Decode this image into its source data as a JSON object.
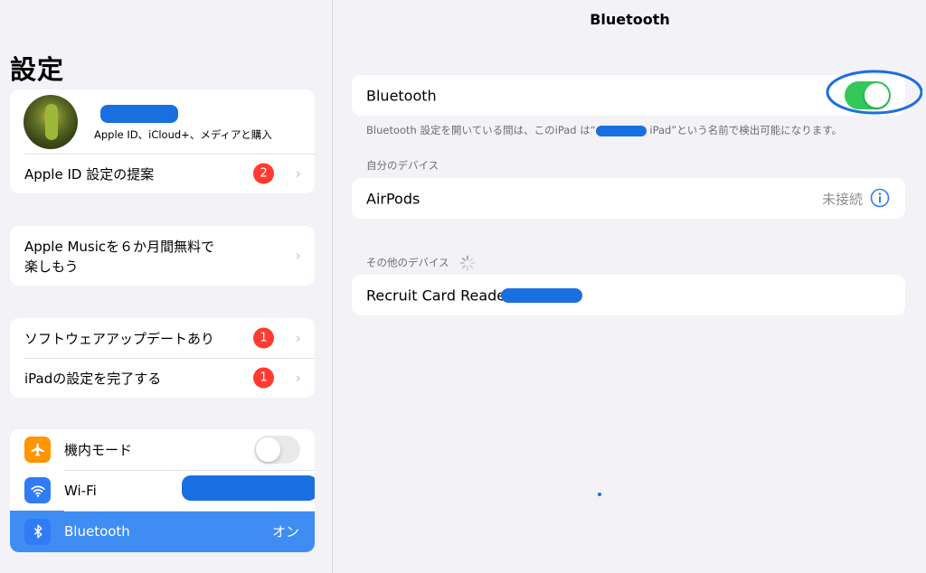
{
  "sidebar": {
    "title": "設定",
    "account": {
      "subtitle": "Apple ID、iCloud+、メディアと購入",
      "suggestion_label": "Apple ID 設定の提案",
      "suggestion_badge": "2"
    },
    "promo": {
      "line1": "Apple Musicを６か月間無料で",
      "line2": "楽しもう"
    },
    "updates": [
      {
        "label": "ソフトウェアアップデートあり",
        "badge": "1"
      },
      {
        "label": "iPadの設定を完了する",
        "badge": "1"
      }
    ],
    "connectivity": [
      {
        "label": "機内モード",
        "icon": "airplane-icon",
        "toggle": "off"
      },
      {
        "label": "Wi-Fi",
        "icon": "wifi-icon"
      },
      {
        "label": "Bluetooth",
        "icon": "bluetooth-icon",
        "value": "オン",
        "selected": true
      }
    ],
    "chevron": "›"
  },
  "main": {
    "nav_title": "Bluetooth",
    "bluetooth_toggle": {
      "label": "Bluetooth",
      "state": "on"
    },
    "visibility_note_prefix": "Bluetooth 設定を開いている間は、このiPad は“",
    "visibility_note_suffix": " iPad”という名前で検出可能になります。",
    "my_devices_header": "自分のデバイス",
    "my_devices": [
      {
        "name": "AirPods",
        "status": "未接続",
        "info_icon": "info-icon"
      }
    ],
    "other_devices_header": "その他のデバイス",
    "other_devices": [
      {
        "name": "Recruit Card Reade"
      }
    ]
  },
  "colors": {
    "accent": "#3f8cf3",
    "toggle_on": "#34c759",
    "badge": "#ff3b30",
    "airplane_bg": "#ff9500",
    "wifi_bg": "#2f7cf6",
    "bluetooth_bg": "#2f7cf6",
    "annotation": "#1a6fe0"
  }
}
